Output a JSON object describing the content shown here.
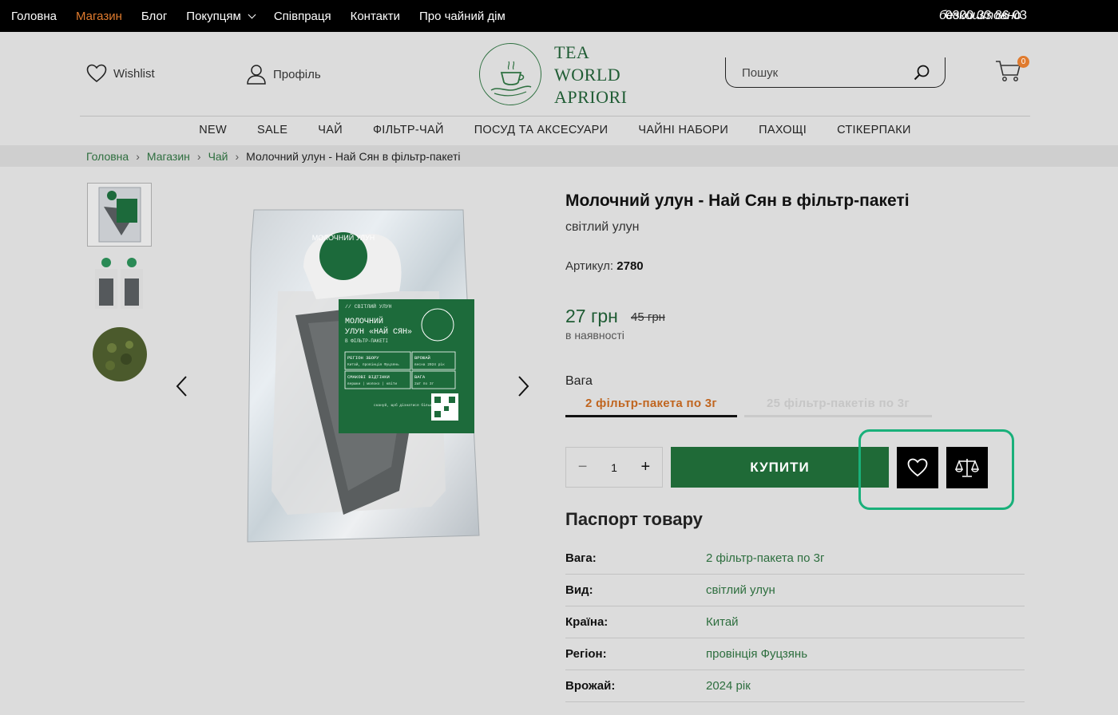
{
  "topbar": {
    "nav": [
      {
        "label": "Головна",
        "active": false
      },
      {
        "label": "Магазин",
        "active": true
      },
      {
        "label": "Блог",
        "active": false
      },
      {
        "label": "Покупцям",
        "active": false,
        "dropdown": true
      },
      {
        "label": "Співпраця",
        "active": false
      },
      {
        "label": "Контакти",
        "active": false
      },
      {
        "label": "Про чайний дім",
        "active": false
      }
    ],
    "phone": "0800 33 86 03",
    "phone_note": "безкоштовно"
  },
  "header": {
    "wishlist_label": "Wishlist",
    "profile_label": "Профіль",
    "logo_text": "TEA\nWORLD\nAPRIORI",
    "search_placeholder": "Пошук",
    "cart_count": "0"
  },
  "main_menu": [
    "NEW",
    "SALE",
    "ЧАЙ",
    "ФІЛЬТР-ЧАЙ",
    "ПОСУД ТА АКСЕСУАРИ",
    "ЧАЙНІ НАБОРИ",
    "ПАХОЩІ",
    "СТІКЕРПАКИ"
  ],
  "breadcrumb": [
    "Головна",
    "Магазин",
    "Чай",
    "Молочний улун - Най Сян в фільтр-пакеті"
  ],
  "product": {
    "title": "Молочний улун - Най Сян в фільтр-пакеті",
    "subtitle": "світлий улун",
    "sku_label": "Артикул:",
    "sku": "2780",
    "price": "27 грн",
    "old_price": "45 грн",
    "stock": "в наявності",
    "weight_label": "Вага",
    "options": [
      "2 фільтр-пакета по 3г",
      "25 фільтр-пакетів по 3г"
    ],
    "selected_option": 0,
    "quantity": "1",
    "buy_label": "КУПИТИ",
    "package_text": {
      "stamp": "МОЛОЧНИЙ УЛУН",
      "category": "// СВІТЛИЙ УЛУН",
      "name_line1": "МОЛОЧНИЙ",
      "name_line2": "УЛУН «НАЙ СЯН»",
      "name_line3": "В ФІЛЬТР-ПАКЕТІ",
      "region_title": "РЕГІОН ЗБОРУ",
      "region_value": "Китай, провінція Фуцзянь",
      "harvest_title": "ВРОЖАЙ",
      "harvest_value": "весна 2024 рік",
      "notes_title": "СМАКОВІ ВІДТІНКИ",
      "notes_value": "вершки | молоко | квіти",
      "weight_title": "ВАГА",
      "weight_value": "2шт по 3г",
      "scan_text": "скануй, щоб дізнатися більше про чай"
    }
  },
  "passport": {
    "title": "Паспорт товару",
    "rows": [
      {
        "key": "Вага:",
        "value": "2 фільтр-пакета по 3г"
      },
      {
        "key": "Вид:",
        "value": "світлий улун"
      },
      {
        "key": "Країна:",
        "value": "Китай"
      },
      {
        "key": "Регіон:",
        "value": "провінція Фуцзянь"
      },
      {
        "key": "Врожай:",
        "value": "2024 рік"
      }
    ]
  },
  "colors": {
    "accent_orange": "#e07b2e",
    "brand_green": "#1f6a37",
    "highlight_teal": "#19b07a"
  }
}
